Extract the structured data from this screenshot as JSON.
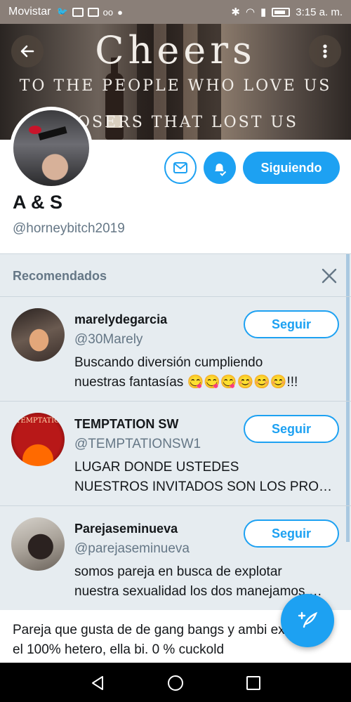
{
  "status_bar": {
    "carrier": "Movistar",
    "time": "3:15 a. m."
  },
  "banner": {
    "title": "Cheers",
    "line1": "TO THE PEOPLE WHO LOVE US",
    "line2": "OSERS THAT LOST US"
  },
  "profile": {
    "name": "A & S",
    "handle": "@horneybitch2019",
    "follow_label": "Siguiendo",
    "bio": "Pareja que gusta de de gang bangs y ambi extremos, el 100% hetero, ella bi. 0 % cuckold"
  },
  "recommended": {
    "title": "Recomendados",
    "items": [
      {
        "name": "marelydegarcia",
        "handle": "@30Marely",
        "bio_line1": "Buscando diversión cumpliendo",
        "bio_line2": "nuestras fantasías 😋😋😋😊😊😊!!!",
        "button": "Seguir"
      },
      {
        "name": "TEMPTATION SW",
        "handle": "@TEMPTATIONSW1",
        "bio_line1": "LUGAR DONDE USTEDES",
        "bio_line2": "NUESTROS INVITADOS SON LOS PROT…",
        "button": "Seguir",
        "avatar_text": "TEMPTATIO"
      },
      {
        "name": "Parejaseminueva",
        "handle": "@parejaseminueva",
        "bio_line1": "somos pareja en busca de explotar",
        "bio_line2": "nuestra sexualidad los dos manejamos …",
        "button": "Seguir"
      }
    ]
  },
  "colors": {
    "accent": "#1da1f2",
    "panel_bg": "#e6ecf0",
    "muted_text": "#657786"
  },
  "icons": [
    "back-arrow-icon",
    "more-vertical-icon",
    "mail-icon",
    "bell-check-icon",
    "close-icon",
    "compose-icon",
    "nav-back-icon",
    "nav-home-icon",
    "nav-recents-icon"
  ]
}
